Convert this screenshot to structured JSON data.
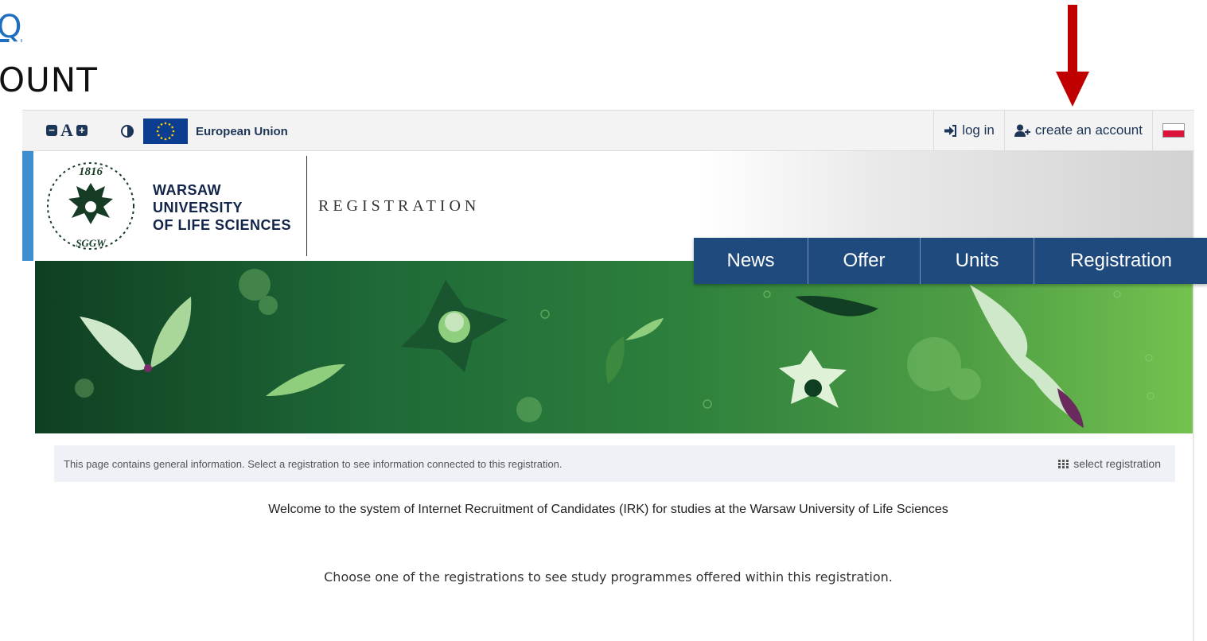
{
  "slide": {
    "top_fragment": "Q",
    "bottom_fragment": "OUNT"
  },
  "topbar": {
    "a11y": {
      "decrease": "−",
      "letter": "A",
      "increase": "+"
    },
    "eu_label": "European Union",
    "login": "log in",
    "create_account": "create an account"
  },
  "header": {
    "seal_year": "1816",
    "seal_abbrev": "SGGW",
    "university": [
      "WARSAW",
      "UNIVERSITY",
      "OF LIFE SCIENCES"
    ],
    "section_title": "REGISTRATION"
  },
  "nav": {
    "items": [
      "News",
      "Offer",
      "Units",
      "Registration"
    ]
  },
  "info": {
    "text": "This page contains general information. Select a registration to see information connected to this registration.",
    "select_registration": "select registration"
  },
  "content": {
    "welcome": "Welcome to the system of Internet Recruitment of Candidates (IRK) for studies at the Warsaw University of Life Sciences",
    "choose": "Choose one of the registrations to see study programmes offered within this registration."
  },
  "colors": {
    "nav_bg": "#1f4a7d",
    "accent": "#3e8fd0",
    "arrow": "#c00000",
    "banner_dark": "#0f3f22",
    "banner_light": "#74c24f"
  }
}
